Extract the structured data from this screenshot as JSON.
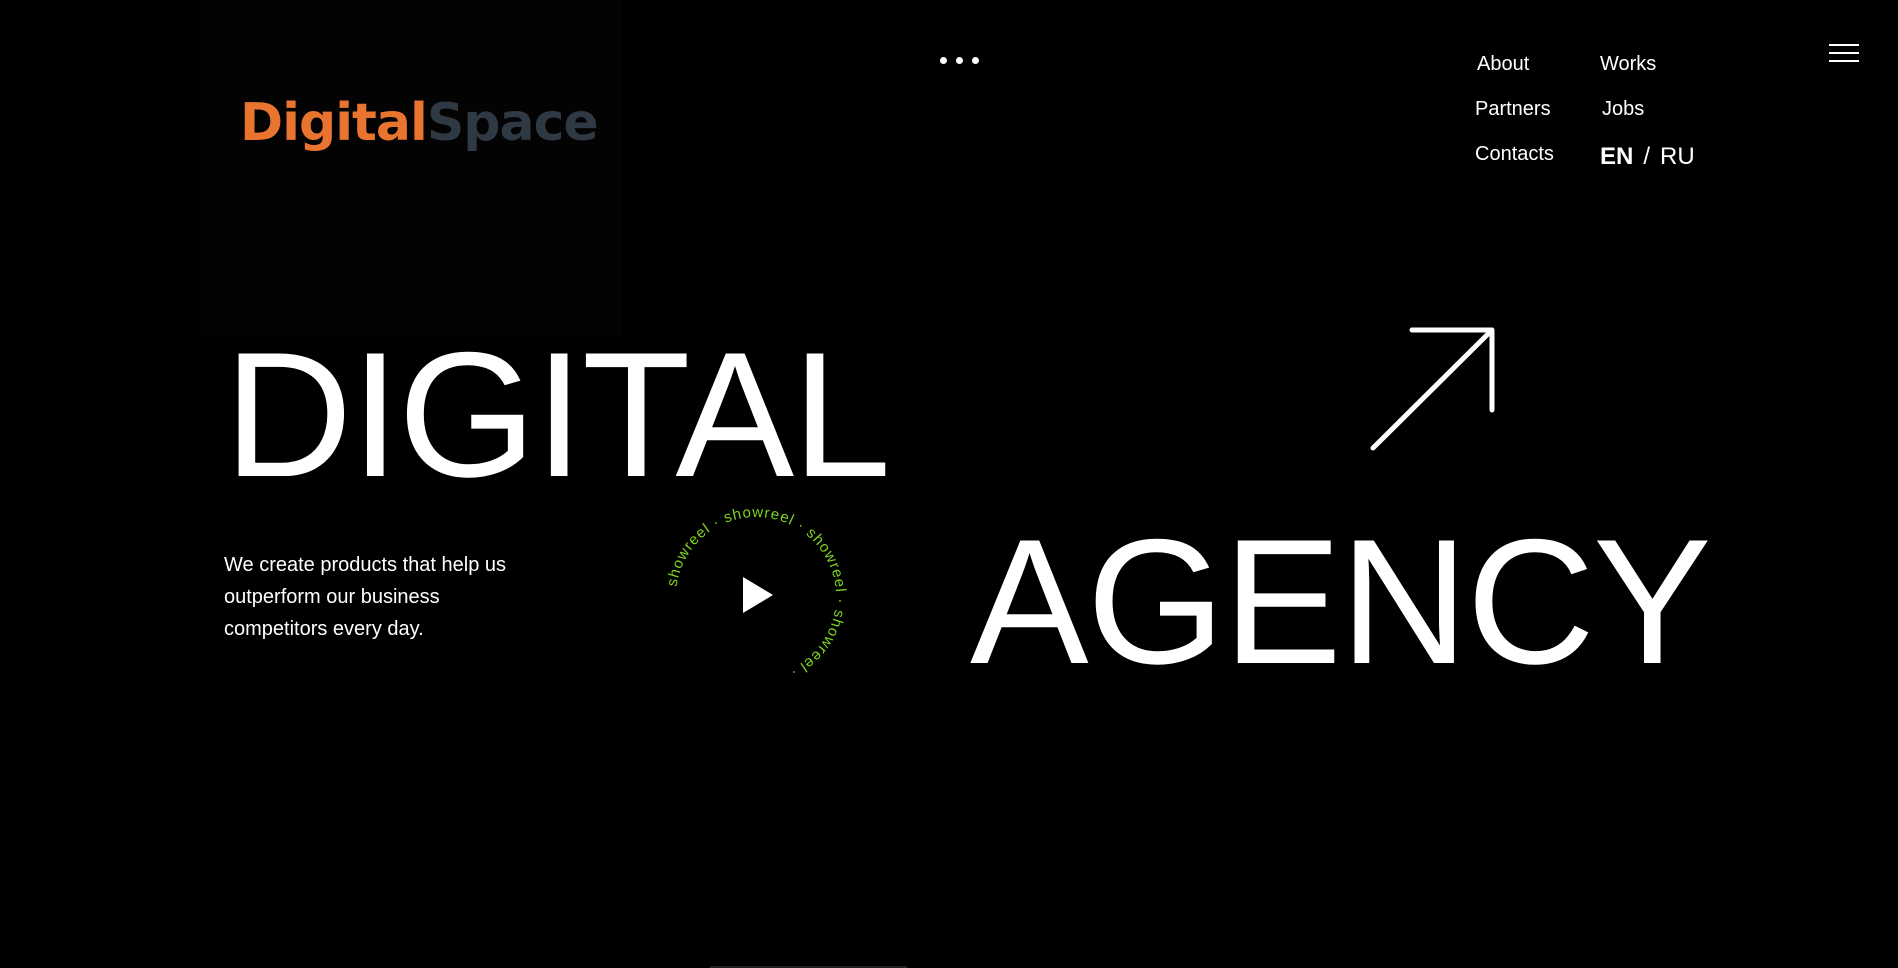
{
  "brand": {
    "logo_part_1": "Digital",
    "logo_part_2": "Space",
    "logo_colors": {
      "digital": "#e8742f",
      "space": "#2f3944"
    }
  },
  "header": {
    "more_icon": "ellipsis-icon",
    "menu_icon": "hamburger-menu-icon"
  },
  "nav": {
    "about": "About",
    "works": "Works",
    "partners": "Partners",
    "jobs": "Jobs",
    "contacts": "Contacts"
  },
  "language": {
    "active": "EN",
    "separator": "/",
    "other": "RU"
  },
  "hero": {
    "word_1": "DIGITAL",
    "word_2": "AGENCY",
    "arrow_icon": "arrow-up-right-icon",
    "tagline": "We create products that help us outperform our business competitors every day."
  },
  "showreel": {
    "ring_text": "showreel · showreel · showreel · showreel · ",
    "play_icon": "play-icon",
    "accent_color": "#7ed321"
  }
}
